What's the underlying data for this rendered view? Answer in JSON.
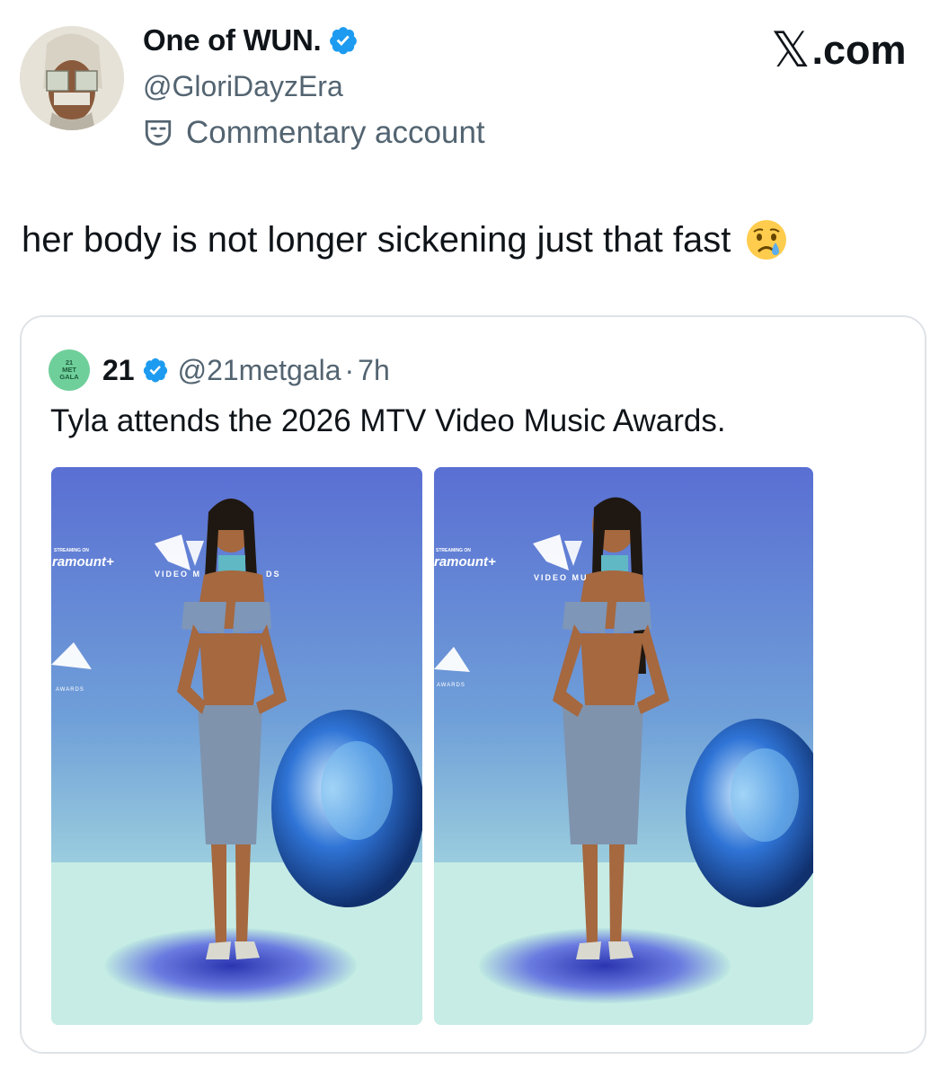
{
  "author": {
    "display_name": "One of WUN.",
    "handle": "@GloriDayzEra",
    "account_label": "Commentary account",
    "verified": true
  },
  "site_logo": {
    "mark": "𝕏",
    "text": ".com"
  },
  "tweet": {
    "text": "her body is not longer sickening just that fast",
    "emoji": "crying-face"
  },
  "quoted": {
    "avatar_text": [
      "21",
      "MET",
      "GALA"
    ],
    "name": "21",
    "verified": true,
    "handle": "@21metgala",
    "separator": "·",
    "time": "7h",
    "text": "Tyla attends the 2026 MTV Video Music Awards.",
    "photos": [
      {
        "backdrop_texts": [
          "STREAMING ON",
          "ramount+",
          "VIDEO M",
          "DS",
          "AWARDS"
        ]
      },
      {
        "backdrop_texts": [
          "STREAMING ON",
          "ramount+",
          "VIDEO MU",
          "AWARDS"
        ]
      }
    ]
  },
  "colors": {
    "verified_badge": "#1d9bf0",
    "secondary_text": "#536471",
    "card_border": "#dfe3e7",
    "backdrop_top": "#5a6fd3",
    "backdrop_bottom": "#bfe9e2",
    "quote_avatar": "#6fcf9a"
  }
}
